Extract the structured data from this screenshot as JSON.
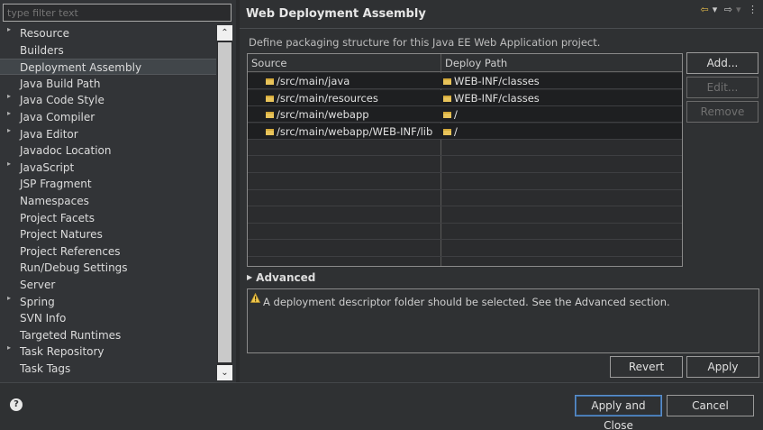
{
  "filter": {
    "placeholder": "type filter text"
  },
  "tree": [
    {
      "label": "Resource",
      "expandable": true
    },
    {
      "label": "Builders",
      "expandable": false
    },
    {
      "label": "Deployment Assembly",
      "expandable": false,
      "selected": true
    },
    {
      "label": "Java Build Path",
      "expandable": false
    },
    {
      "label": "Java Code Style",
      "expandable": true
    },
    {
      "label": "Java Compiler",
      "expandable": true
    },
    {
      "label": "Java Editor",
      "expandable": true
    },
    {
      "label": "Javadoc Location",
      "expandable": false
    },
    {
      "label": "JavaScript",
      "expandable": true
    },
    {
      "label": "JSP Fragment",
      "expandable": false
    },
    {
      "label": "Namespaces",
      "expandable": false
    },
    {
      "label": "Project Facets",
      "expandable": false
    },
    {
      "label": "Project Natures",
      "expandable": false
    },
    {
      "label": "Project References",
      "expandable": false
    },
    {
      "label": "Run/Debug Settings",
      "expandable": false
    },
    {
      "label": "Server",
      "expandable": false
    },
    {
      "label": "Spring",
      "expandable": true
    },
    {
      "label": "SVN Info",
      "expandable": false
    },
    {
      "label": "Targeted Runtimes",
      "expandable": false
    },
    {
      "label": "Task Repository",
      "expandable": true
    },
    {
      "label": "Task Tags",
      "expandable": false
    }
  ],
  "page": {
    "title": "Web Deployment Assembly",
    "description": "Define packaging structure for this Java EE Web Application project."
  },
  "table": {
    "columns": [
      "Source",
      "Deploy Path"
    ],
    "rows": [
      {
        "source": "/src/main/java",
        "deploy": "WEB-INF/classes"
      },
      {
        "source": "/src/main/resources",
        "deploy": "WEB-INF/classes"
      },
      {
        "source": "/src/main/webapp",
        "deploy": "/"
      },
      {
        "source": "/src/main/webapp/WEB-INF/lib",
        "deploy": "/"
      }
    ]
  },
  "buttons": {
    "add": "Add...",
    "edit": "Edit...",
    "remove": "Remove",
    "revert": "Revert",
    "apply": "Apply",
    "apply_close": "Apply and Close",
    "cancel": "Cancel"
  },
  "advanced": {
    "label": "Advanced"
  },
  "message": "A deployment descriptor folder should be selected. See the Advanced section.",
  "colors": {
    "folder": "#e8c35a",
    "warning": "#f2c94c",
    "accent": "#5c8ec8"
  }
}
